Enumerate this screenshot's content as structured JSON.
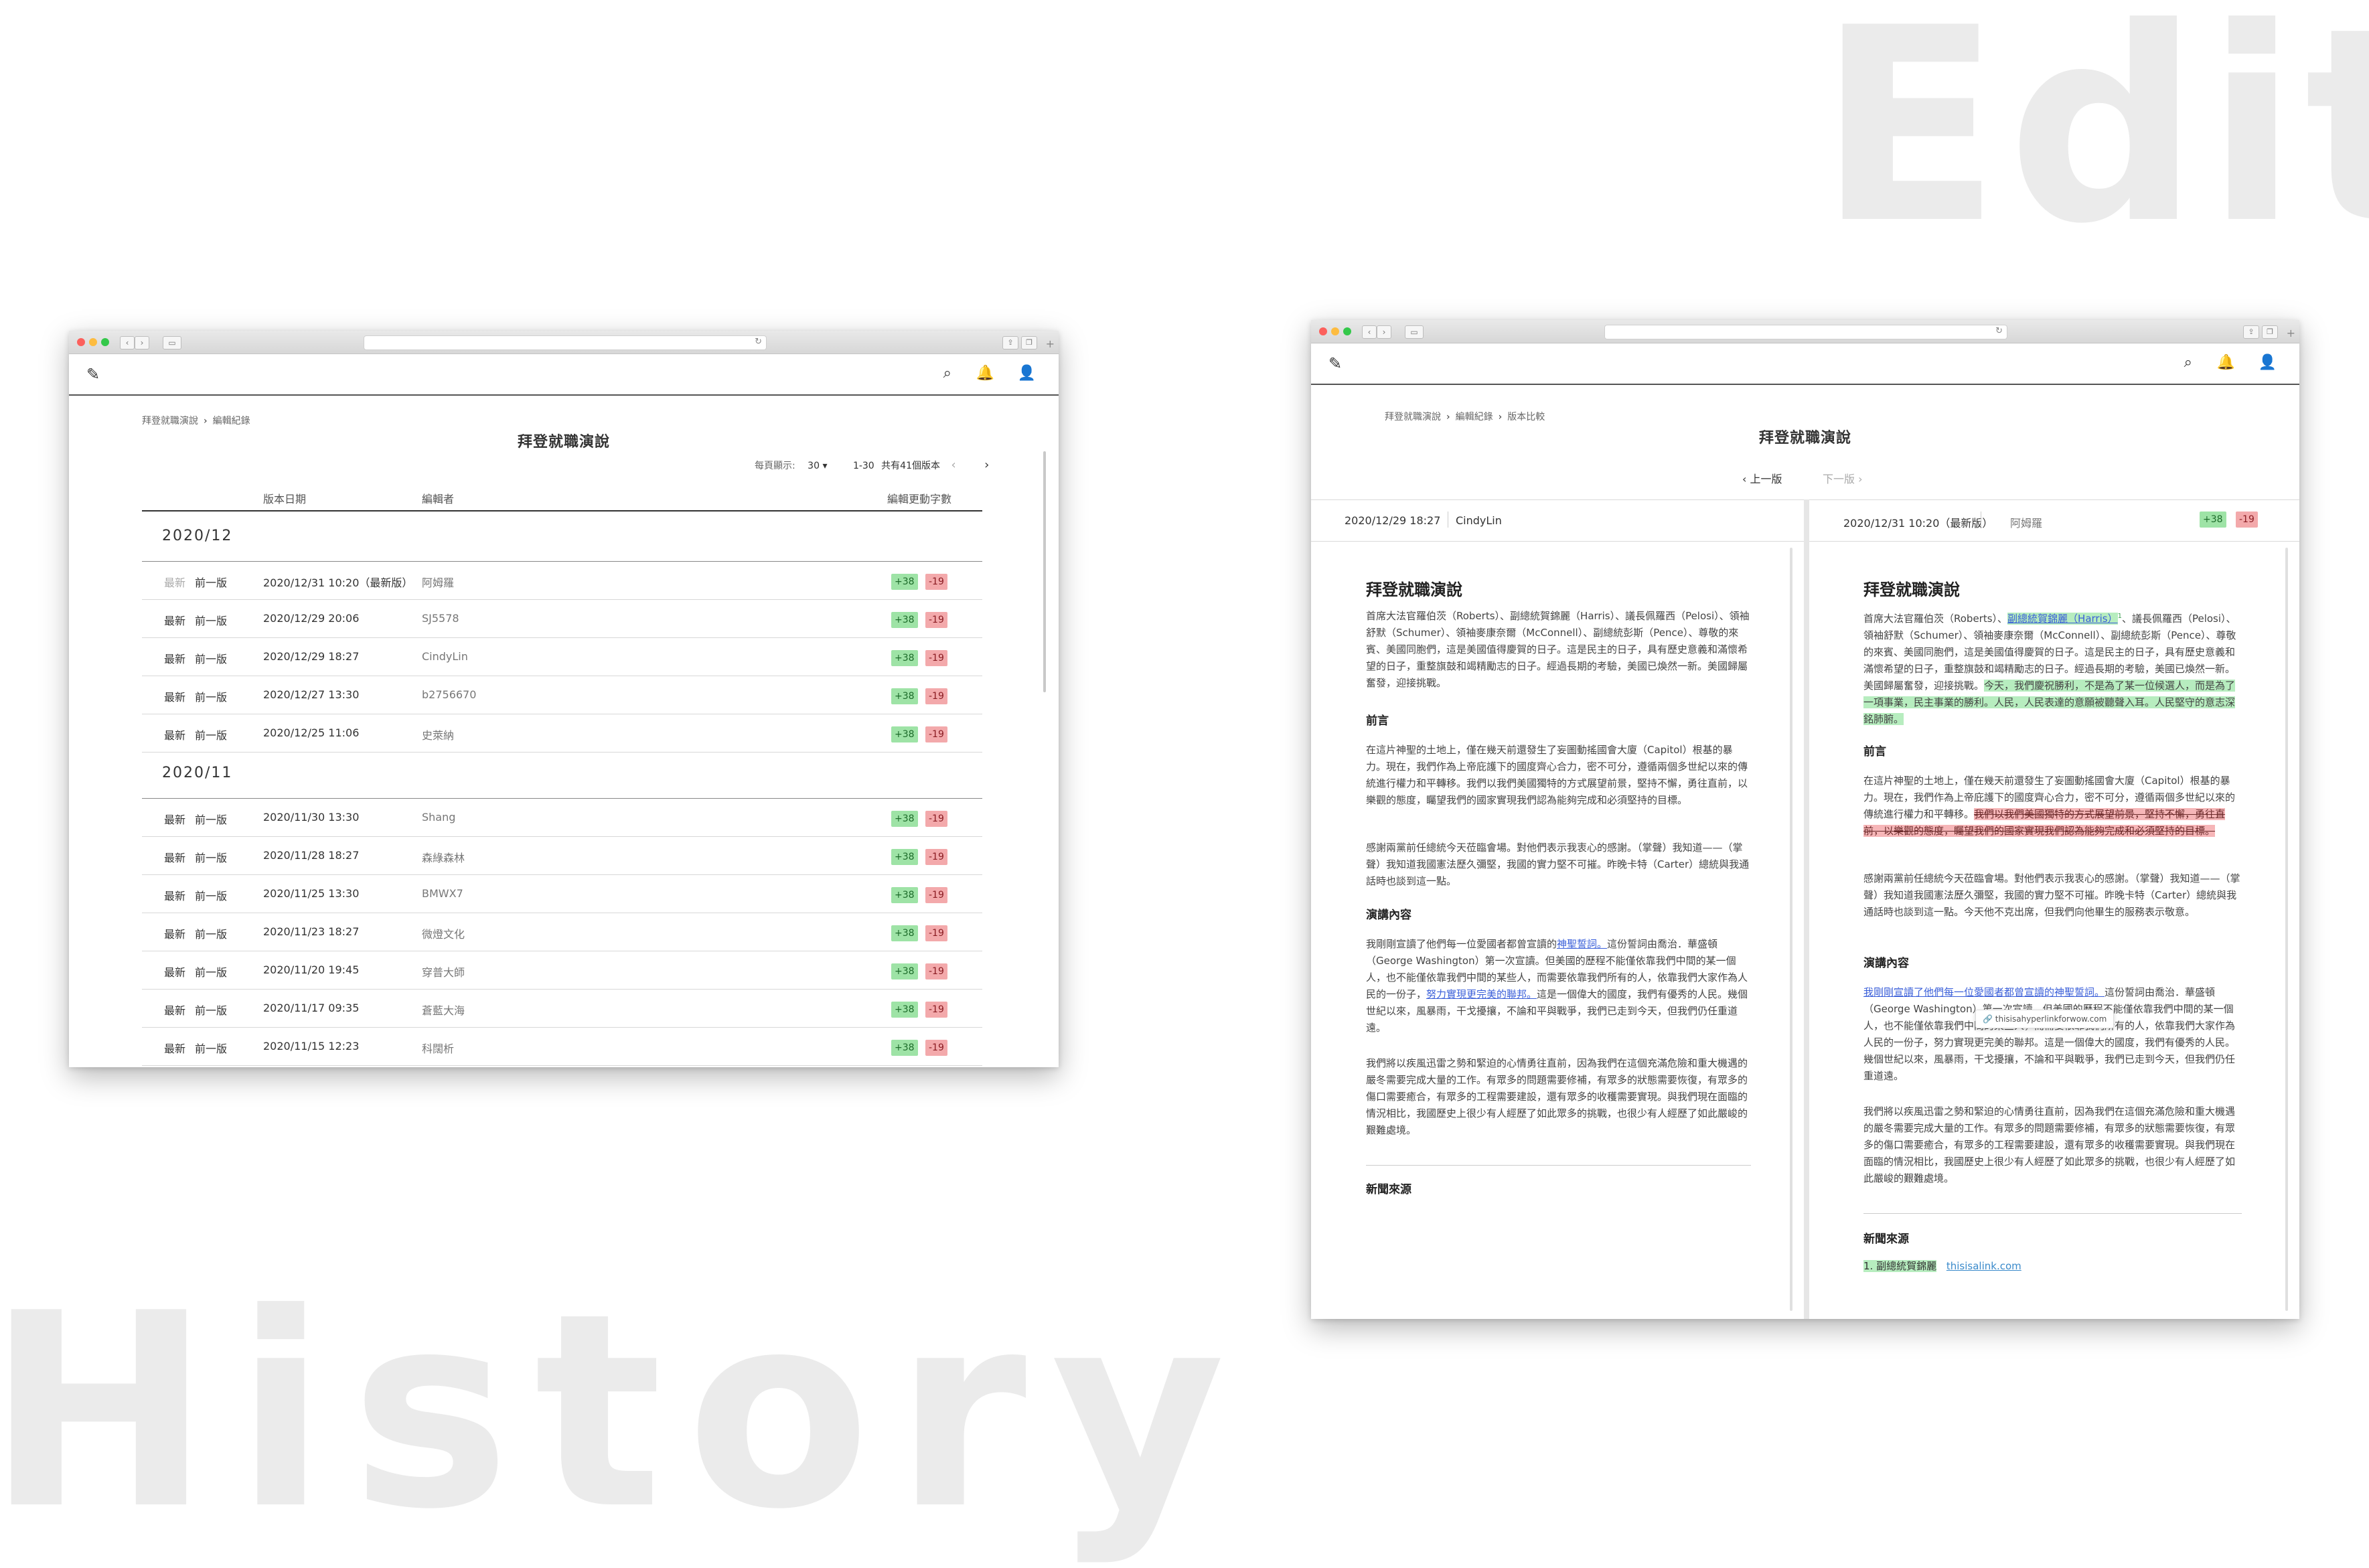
{
  "background": {
    "left_word": "History",
    "right_word": "Edit"
  },
  "history": {
    "breadcrumb": [
      "拜登就職演說",
      "編輯紀錄"
    ],
    "title": "拜登就職演說",
    "pager": {
      "per_page_label": "每頁顯示:",
      "per_page_value": "30",
      "range": "1-30",
      "total": "共有41個版本"
    },
    "columns": {
      "date": "版本日期",
      "editor": "編輯者",
      "changes": "編輯更動字數"
    },
    "groups": [
      {
        "month": "2020/12",
        "rows": [
          {
            "latest": "最新",
            "prev": "前一版",
            "date": "2020/12/31 10:20（最新版）",
            "editor": "阿姆羅",
            "plus": "+38",
            "minus": "-19",
            "latest_disabled": true
          },
          {
            "latest": "最新",
            "prev": "前一版",
            "date": "2020/12/29 20:06",
            "editor": "SJ5578",
            "plus": "+38",
            "minus": "-19"
          },
          {
            "latest": "最新",
            "prev": "前一版",
            "date": "2020/12/29 18:27",
            "editor": "CindyLin",
            "plus": "+38",
            "minus": "-19"
          },
          {
            "latest": "最新",
            "prev": "前一版",
            "date": "2020/12/27 13:30",
            "editor": "b2756670",
            "plus": "+38",
            "minus": "-19"
          },
          {
            "latest": "最新",
            "prev": "前一版",
            "date": "2020/12/25 11:06",
            "editor": "史萊納",
            "plus": "+38",
            "minus": "-19"
          }
        ]
      },
      {
        "month": "2020/11",
        "rows": [
          {
            "latest": "最新",
            "prev": "前一版",
            "date": "2020/11/30 13:30",
            "editor": "Shang",
            "plus": "+38",
            "minus": "-19"
          },
          {
            "latest": "最新",
            "prev": "前一版",
            "date": "2020/11/28 18:27",
            "editor": "森綠森林",
            "plus": "+38",
            "minus": "-19"
          },
          {
            "latest": "最新",
            "prev": "前一版",
            "date": "2020/11/25 13:30",
            "editor": "BMWX7",
            "plus": "+38",
            "minus": "-19"
          },
          {
            "latest": "最新",
            "prev": "前一版",
            "date": "2020/11/23 18:27",
            "editor": "微燈文化",
            "plus": "+38",
            "minus": "-19"
          },
          {
            "latest": "最新",
            "prev": "前一版",
            "date": "2020/11/20 19:45",
            "editor": "穿普大師",
            "plus": "+38",
            "minus": "-19"
          },
          {
            "latest": "最新",
            "prev": "前一版",
            "date": "2020/11/17 09:35",
            "editor": "蒼藍大海",
            "plus": "+38",
            "minus": "-19"
          },
          {
            "latest": "最新",
            "prev": "前一版",
            "date": "2020/11/15 12:23",
            "editor": "科闊析",
            "plus": "+38",
            "minus": "-19"
          }
        ]
      }
    ]
  },
  "compare": {
    "breadcrumb": [
      "拜登就職演說",
      "編輯紀錄",
      "版本比較"
    ],
    "title": "拜登就職演說",
    "prev_label": "上一版",
    "next_label": "下一版",
    "left": {
      "date": "2020/12/29 18:27",
      "editor": "CindyLin"
    },
    "right": {
      "date": "2020/12/31 10:20（最新版）",
      "editor": "阿姆羅",
      "plus": "+38",
      "minus": "-19"
    },
    "doc": {
      "title": "拜登就職演說",
      "intro": "首席大法官羅伯茨（Roberts）、副總統賀錦麗（Harris）、議長佩羅西（Pelosi）、領袖舒默（Schumer）、領袖麥康奈爾（McConnell）、副總統彭斯（Pence）、尊敬的來賓、美國同胞們，這是美國值得慶賀的日子。這是民主的日子，具有歷史意義和滿懷希望的日子，重整旗鼓和竭精勵志的日子。經過長期的考驗，美國已煥然一新。美國歸屬奮發，迎接挑戰。",
      "intro_r_a": "首席大法官羅伯茨（Roberts）、",
      "intro_r_link": "副總統賀錦麗（Harris）",
      "intro_r_b": "、議長佩羅西（Pelosi）、領袖舒默（Schumer）、領袖麥康奈爾（McConnell）、副總統彭斯（Pence）、尊敬的來賓、美國同胞們，這是美國值得慶賀的日子。這是民主的日子，具有歷史意義和滿懷希望的日子，重整旗鼓和竭精勵志的日子。經過長期的考驗，美國已煥然一新。美國歸屬奮發，迎接挑戰。",
      "intro_r_ins": "今天，我們慶祝勝利，不是為了某一位候選人，而是為了一項事業，民主事業的勝利。人民，人民表達的意願被聽聲入耳。人民堅守的意志深銘肺腑。",
      "footnote_mark": "1",
      "h_preface": "前言",
      "preface_1": "在這片神聖的土地上，僅在幾天前還發生了妄圖動搖國會大廈（Capitol）根基的暴力。現在，我們作為上帝庇護下的國度齊心合力，密不可分，遵循兩個多世紀以來的傳統進行權力和平轉移。我們以我們美國獨特的方式展望前景，堅持不懈，勇往直前，以樂觀的態度，矚望我們的國家實現我們認為能夠完成和必須堅持的目標。",
      "preface_r_plain": "在這片神聖的土地上，僅在幾天前還發生了妄圖動搖國會大廈（Capitol）根基的暴力。現在，我們作為上帝庇護下的國度齊心合力，密不可分，遵循兩個多世紀以來的傳統進行權力和平轉移。",
      "preface_r_del": "我們以我們美國獨特的方式展望前景，堅持不懈，勇往直前，以樂觀的態度，矚望我們的國家實現我們認為能夠完成和必須堅持的目標。",
      "preface_2": "感謝兩黨前任總統今天莅臨會場。對他們表示我衷心的感謝。（掌聲）我知道——（掌聲）我知道我國憲法歷久彌堅，我國的實力堅不可摧。昨晚卡特（Carter）總統與我通話時也談到這一點。",
      "preface_2_r": "感謝兩黨前任總統今天莅臨會場。對他們表示我衷心的感謝。（掌聲）我知道——（掌聲）我知道我國憲法歷久彌堅，我國的實力堅不可摧。昨晚卡特（Carter）總統與我通話時也談到這一點。今天他不克出席，但我們向他畢生的服務表示敬意。",
      "h_speech": "演講內容",
      "speech_1a": "我剛剛宣讀了他們每一位愛國者都曾宣讀的",
      "speech_1_link": "神聖誓詞。",
      "speech_1b": "這份誓詞由喬治．華盛頓（George Washington）第一次宣讀。但美國的歷程不能僅依靠我們中間的某一個人，也不能僅依靠我們中間的某些人，而需要依靠我們所有的人，依靠我們大家作為人民的一份子，",
      "speech_1_link2": "努力實現更完美的聯邦。",
      "speech_1c": "這是一個偉大的國度，我們有優秀的人民。幾個世紀以來，風暴雨，干戈擾攘，不論和平與戰爭，我們已走到今天，但我們仍任重道遠。",
      "speech_r_link": "我剛剛宣讀了他們每一位愛國者都曾宣讀的神聖誓詞。",
      "speech_r_b": "這份誓詞由喬治．華盛頓（George Washington）第一次宣讀。但美國的歷程不能僅依靠我們中間的某一個人，也不能僅依靠我們中間的某些人，而需要依靠我們所有的人，依靠我們大家作為人民的一份子，努力實現更完美的聯邦。這是一個偉大的國度，我們有優秀的人民。幾個世紀以來，風暴雨，干戈擾攘，不論和平與戰爭，我們已走到今天，但我們仍任重道遠。",
      "speech_2": "我們將以疾風迅雷之勢和緊迫的心情勇往直前，因為我們在這個充滿危險和重大機遇的嚴冬需要完成大量的工作。有眾多的問題需要修補，有眾多的狀態需要恢復，有眾多的傷口需要癒合，有眾多的工程需要建設，還有眾多的收穫需要實現。與我們現在面臨的情況相比，我國歷史上很少有人經歷了如此眾多的挑戰，也很少有人經歷了如此嚴峻的艱難處境。",
      "tooltip": "thisisahyperlinkforwow.com",
      "h_source": "新聞來源",
      "source_item": "1. 副總統賀錦麗",
      "source_link": "thisisalink.com"
    }
  }
}
